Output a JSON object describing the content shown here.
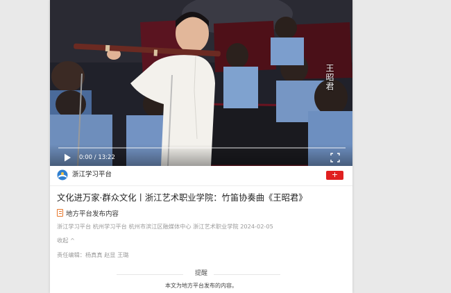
{
  "video": {
    "overlay_title": "王昭君",
    "current_time": "0:00",
    "duration": "13:22",
    "time_display": "0:00 / 13:22",
    "progress": 0
  },
  "source": {
    "name": "浙江学习平台",
    "follow_label": "+"
  },
  "article": {
    "title": "文化进万家·群众文化丨浙江艺术职业学院：竹笛协奏曲《王昭君》",
    "publish_tag": "地方平台发布内容",
    "meta": "浙江学习平台 杭州学习平台 杭州市滨江区融媒体中心 浙江艺术职业学院 2024-02-05",
    "collapse_label": "收起 ^",
    "editors": "责任编辑：杨真真 赵显 王璐"
  },
  "notice": {
    "title": "提醒",
    "text": "本文为地方平台发布的内容。"
  },
  "colors": {
    "accent_red": "#e02020",
    "publish_icon": "#e7762a",
    "meta_gray": "#9a9a9a"
  }
}
